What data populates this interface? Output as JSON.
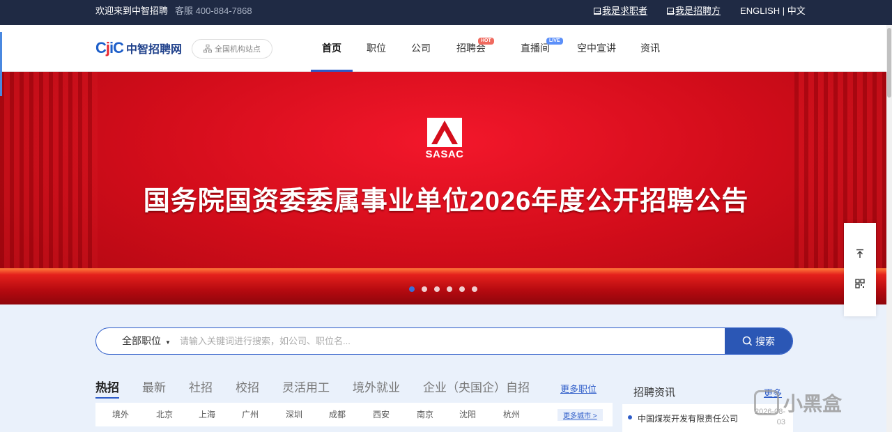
{
  "topbar": {
    "welcome": "欢迎来到中智招聘",
    "service": "客服 400-884-7868",
    "job_seeker": "我是求职者",
    "recruiter": "我是招聘方",
    "lang_en": "ENGLISH",
    "lang_sep": " | ",
    "lang_cn": "中文"
  },
  "header": {
    "logo_text": "中智招聘网",
    "site_btn": "全国机构站点",
    "nav": [
      {
        "label": "首页"
      },
      {
        "label": "职位"
      },
      {
        "label": "公司"
      },
      {
        "label": "招聘会",
        "badge": "HOT"
      },
      {
        "label": "直播间",
        "badge": "LIVE"
      },
      {
        "label": "空中宣讲"
      },
      {
        "label": "资讯"
      }
    ]
  },
  "banner": {
    "logo_text": "SASAC",
    "headline": "国务院国资委委属事业单位2026年度公开招聘公告",
    "active_slide": 1,
    "slide_count": 6
  },
  "float": {
    "top_icon": "arrow-up-icon",
    "qr_icon": "qrcode-icon"
  },
  "search": {
    "category": "全部职位",
    "placeholder": "请输入关键词进行搜索，如公司、职位名...",
    "button": "搜索"
  },
  "tabs": {
    "items": [
      "热招",
      "最新",
      "社招",
      "校招",
      "灵活用工",
      "境外就业",
      "企业（央国企）自招"
    ],
    "more": "更多职位"
  },
  "cities": {
    "items": [
      "境外",
      "北京",
      "上海",
      "广州",
      "深圳",
      "成都",
      "西安",
      "南京",
      "沈阳",
      "杭州"
    ],
    "more": "更多城市 >"
  },
  "news": {
    "title": "招聘资讯",
    "more": "更多",
    "items": [
      {
        "title": "中国煤炭开发有限责任公司",
        "date": "2026-08-03"
      }
    ]
  },
  "watermark": "小黑盒",
  "colors": {
    "topbar": "#1f2a44",
    "accent": "#2c5bc8",
    "banner_red": "#d40d1b"
  }
}
